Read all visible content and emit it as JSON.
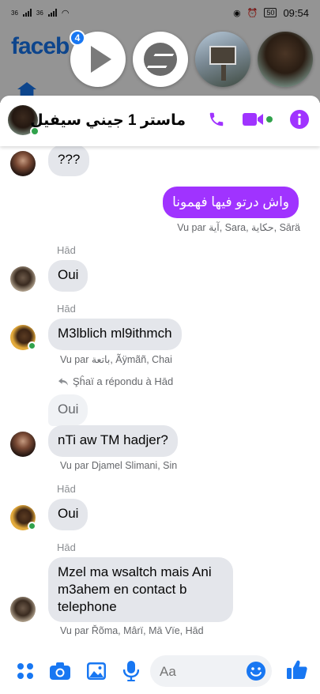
{
  "status_bar": {
    "left_labels": [
      "36",
      "36"
    ],
    "battery": "50",
    "time": "09:54"
  },
  "background_app": {
    "logo_text": "faceb",
    "badge_count": "4"
  },
  "chat_heads": [
    {
      "name": "video-head",
      "icon": "play-icon"
    },
    {
      "name": "messenger-head",
      "icon": "messenger-icon"
    },
    {
      "name": "group-head-building",
      "icon": "building-photo"
    },
    {
      "name": "contact-head-curly",
      "icon": "portrait-photo"
    }
  ],
  "header": {
    "title": "ماستر 1 جيني سيفيل",
    "icons": [
      "phone-icon",
      "video-icon",
      "info-icon"
    ]
  },
  "messages": [
    {
      "id": "m1",
      "type": "in",
      "text": "???"
    },
    {
      "id": "m2",
      "type": "out",
      "text": "واش درتو فيها فهمونا"
    },
    {
      "id": "r2",
      "type": "read",
      "text": "Vu par آية, Sara, حكاية, Sārä"
    },
    {
      "id": "s3",
      "type": "sender",
      "text": "Hād"
    },
    {
      "id": "m3",
      "type": "in",
      "text": "Oui"
    },
    {
      "id": "s4",
      "type": "sender",
      "text": "Hād"
    },
    {
      "id": "m4",
      "type": "in",
      "text": "M3lblich ml9ithmch"
    },
    {
      "id": "r4",
      "type": "read",
      "text": "Vu par باتعة, Ãÿmãñ, Chai"
    },
    {
      "id": "rp5",
      "type": "reply_note",
      "text": "Şĥaï a répondu à Hād"
    },
    {
      "id": "q5",
      "type": "quoted",
      "text": "Oui"
    },
    {
      "id": "m5",
      "type": "in",
      "text": "nTi aw TM hadjer?"
    },
    {
      "id": "r5",
      "type": "read",
      "text": "Vu par Djamel Slimani, Sin"
    },
    {
      "id": "s6",
      "type": "sender",
      "text": "Hād"
    },
    {
      "id": "m6",
      "type": "in",
      "text": "Oui"
    },
    {
      "id": "s7",
      "type": "sender",
      "text": "Hād"
    },
    {
      "id": "m7",
      "type": "in",
      "text": "Mzel ma wsaltch mais Ani m3ahem en contact b telephone"
    },
    {
      "id": "r7",
      "type": "read",
      "text": "Vu par Řõma, Mârï, Mā Vïe, Hād"
    }
  ],
  "composer": {
    "placeholder": "Aa",
    "icons": [
      "menu-icon",
      "camera-icon",
      "gallery-icon",
      "mic-icon",
      "emoji-icon",
      "like-icon"
    ]
  },
  "colors": {
    "accent_purple": "#a033ff",
    "facebook_blue": "#1877f2",
    "online_green": "#31a24c",
    "bubble_gray": "#e4e6eb"
  }
}
